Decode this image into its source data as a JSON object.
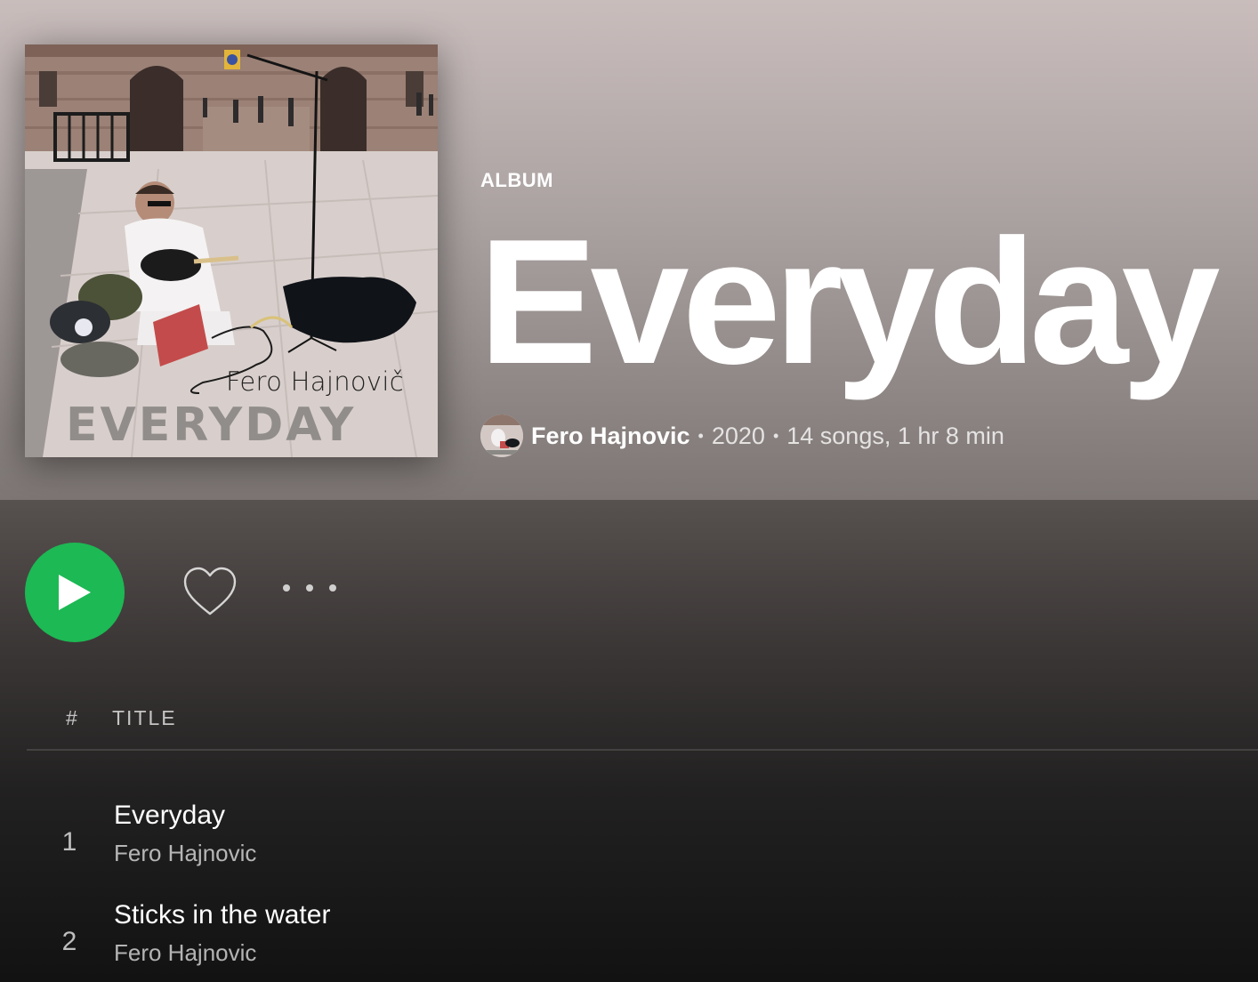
{
  "album": {
    "type_label": "ALBUM",
    "title": "Everyday",
    "cover_artist_text": "Fero Hajnovič",
    "cover_title_text": "EVERYDAY",
    "artist": "Fero Hajnovic",
    "separator": "•",
    "year": "2020",
    "summary": "14 songs, 1 hr 8 min"
  },
  "actions": {
    "play_icon": "play-icon",
    "like_icon": "heart-icon",
    "more_icon": "more-horizontal-icon",
    "accent_color": "#1db954"
  },
  "table": {
    "col_number": "#",
    "col_title": "TITLE"
  },
  "tracks": [
    {
      "number": "1",
      "title": "Everyday",
      "artist": "Fero Hajnovic"
    },
    {
      "number": "2",
      "title": "Sticks in the water",
      "artist": "Fero Hajnovic"
    }
  ]
}
